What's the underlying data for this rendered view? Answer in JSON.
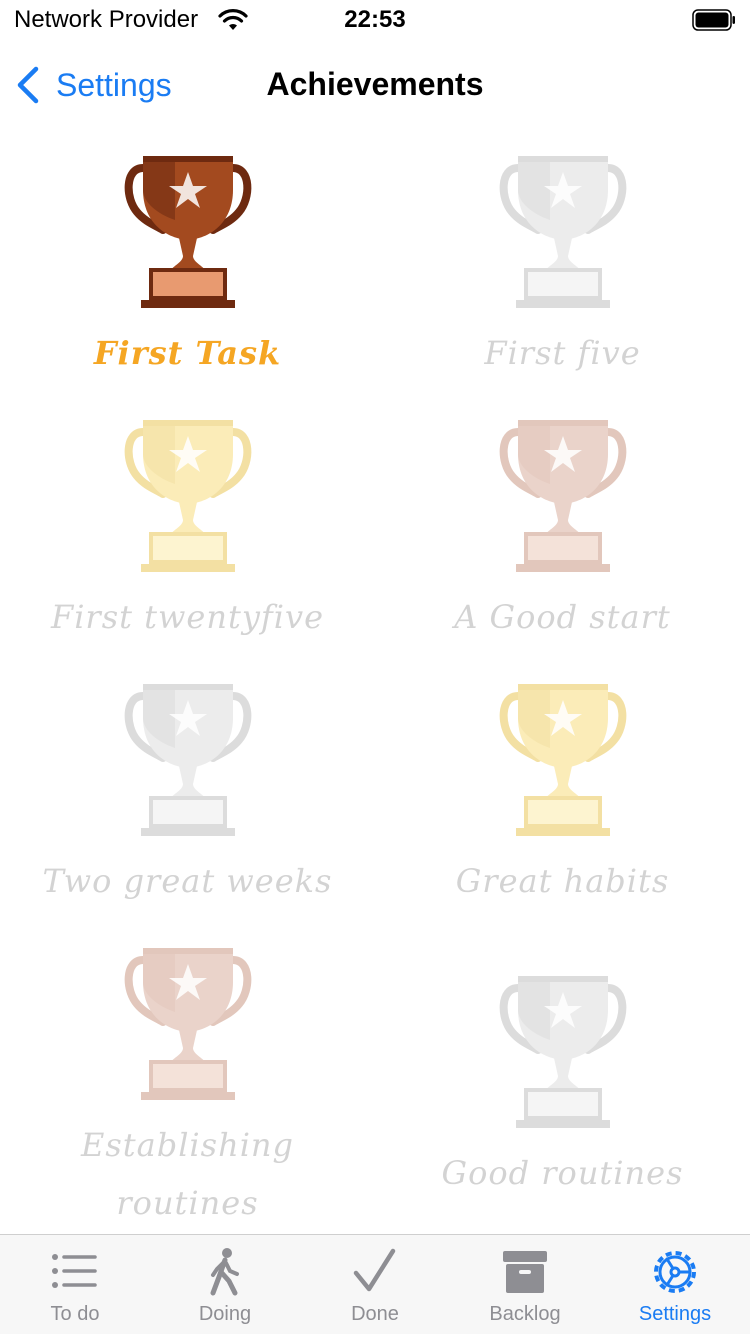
{
  "status_bar": {
    "carrier": "Network Provider",
    "time": "22:53"
  },
  "nav": {
    "back_label": "Settings",
    "title": "Achievements"
  },
  "achievements": [
    {
      "label": "First Task",
      "tier": "bronze",
      "earned": true
    },
    {
      "label": "First five",
      "tier": "silver",
      "earned": false
    },
    {
      "label": "First twentyfive",
      "tier": "gold",
      "earned": false
    },
    {
      "label": "A Good start",
      "tier": "bronze",
      "earned": false
    },
    {
      "label": "Two great weeks",
      "tier": "silver",
      "earned": false
    },
    {
      "label": "Great habits",
      "tier": "gold",
      "earned": false
    },
    {
      "label": "Establishing routines",
      "tier": "bronze",
      "earned": false
    },
    {
      "label": "Good routines",
      "tier": "silver",
      "earned": false
    }
  ],
  "tabs": [
    {
      "label": "To do",
      "icon": "list-icon",
      "active": false
    },
    {
      "label": "Doing",
      "icon": "walking-person-icon",
      "active": false
    },
    {
      "label": "Done",
      "icon": "checkmark-icon",
      "active": false
    },
    {
      "label": "Backlog",
      "icon": "archive-box-icon",
      "active": false
    },
    {
      "label": "Settings",
      "icon": "gear-icon",
      "active": true
    }
  ],
  "colors": {
    "accent": "#1a7cf3",
    "earned_label": "#f5a623",
    "locked_label": "#d3d3d3",
    "tab_inactive": "#8e8e93"
  }
}
